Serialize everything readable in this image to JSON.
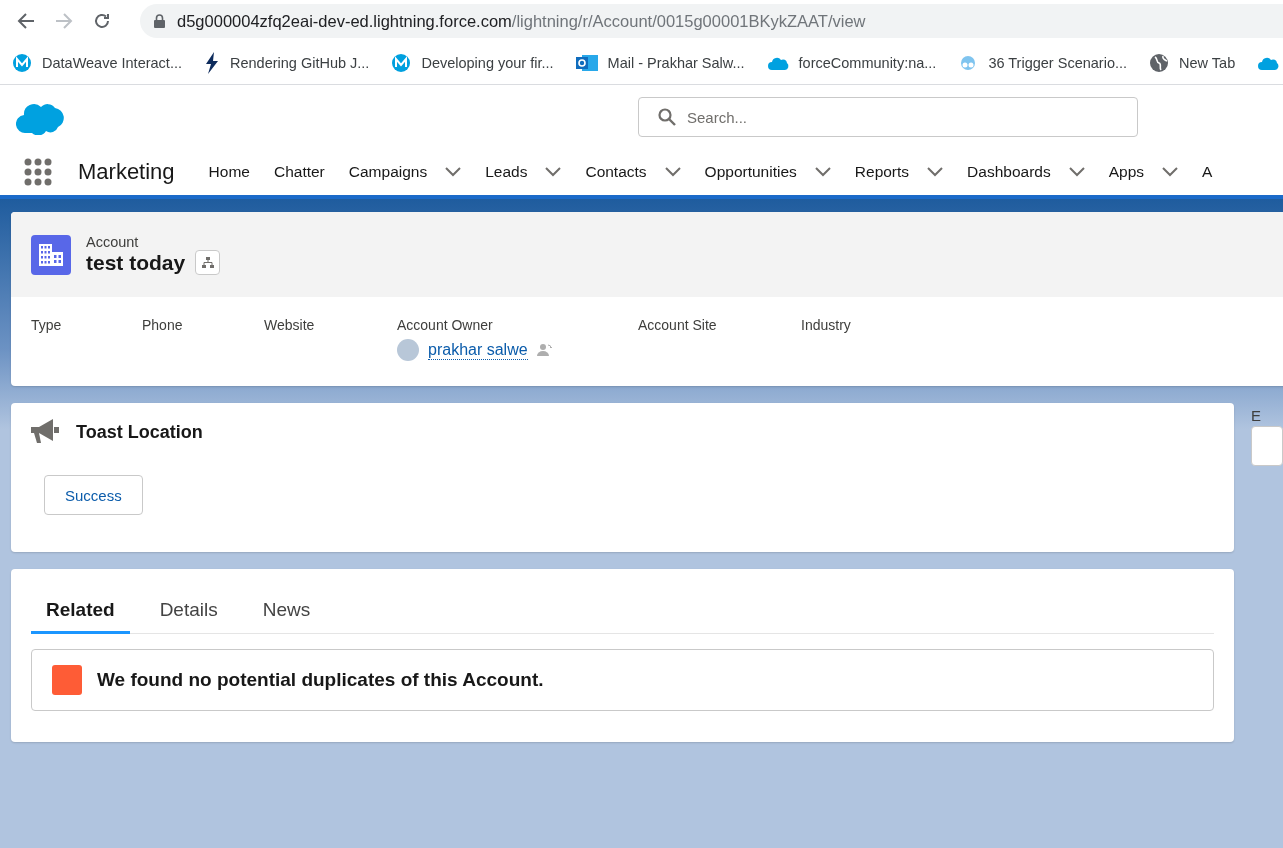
{
  "browser": {
    "url_domain": "d5g000004zfq2eai-dev-ed.lightning.force.com",
    "url_path": "/lightning/r/Account/0015g00001BKykZAAT/view",
    "bookmarks": [
      {
        "label": "DataWeave Interact...",
        "kind": "mule"
      },
      {
        "label": "Rendering GitHub J...",
        "kind": "bolt"
      },
      {
        "label": "Developing your fir...",
        "kind": "mule"
      },
      {
        "label": "Mail - Prakhar Salw...",
        "kind": "mail"
      },
      {
        "label": "forceCommunity:na...",
        "kind": "cloud"
      },
      {
        "label": "36 Trigger Scenario...",
        "kind": "astro"
      },
      {
        "label": "New Tab",
        "kind": "globe"
      },
      {
        "kind": "cloud"
      }
    ]
  },
  "header": {
    "search_placeholder": "Search..."
  },
  "nav": {
    "app_name": "Marketing",
    "items": [
      {
        "label": "Home",
        "menu": false
      },
      {
        "label": "Chatter",
        "menu": false
      },
      {
        "label": "Campaigns",
        "menu": true
      },
      {
        "label": "Leads",
        "menu": true
      },
      {
        "label": "Contacts",
        "menu": true
      },
      {
        "label": "Opportunities",
        "menu": true
      },
      {
        "label": "Reports",
        "menu": true
      },
      {
        "label": "Dashboards",
        "menu": true
      },
      {
        "label": "Apps",
        "menu": true
      },
      {
        "label": "A",
        "menu": false
      }
    ]
  },
  "record": {
    "object": "Account",
    "name": "test today",
    "fields": [
      {
        "label": "Type"
      },
      {
        "label": "Phone"
      },
      {
        "label": "Website"
      },
      {
        "label": "Account Owner",
        "value": "prakhar salwe"
      },
      {
        "label": "Account Site"
      },
      {
        "label": "Industry"
      }
    ]
  },
  "toast_card": {
    "title": "Toast Location",
    "button": "Success"
  },
  "side_label": "E",
  "tabs": [
    {
      "label": "Related",
      "selected": true
    },
    {
      "label": "Details",
      "selected": false
    },
    {
      "label": "News",
      "selected": false
    }
  ],
  "duplicates": {
    "message": "We found no potential duplicates of this Account."
  }
}
